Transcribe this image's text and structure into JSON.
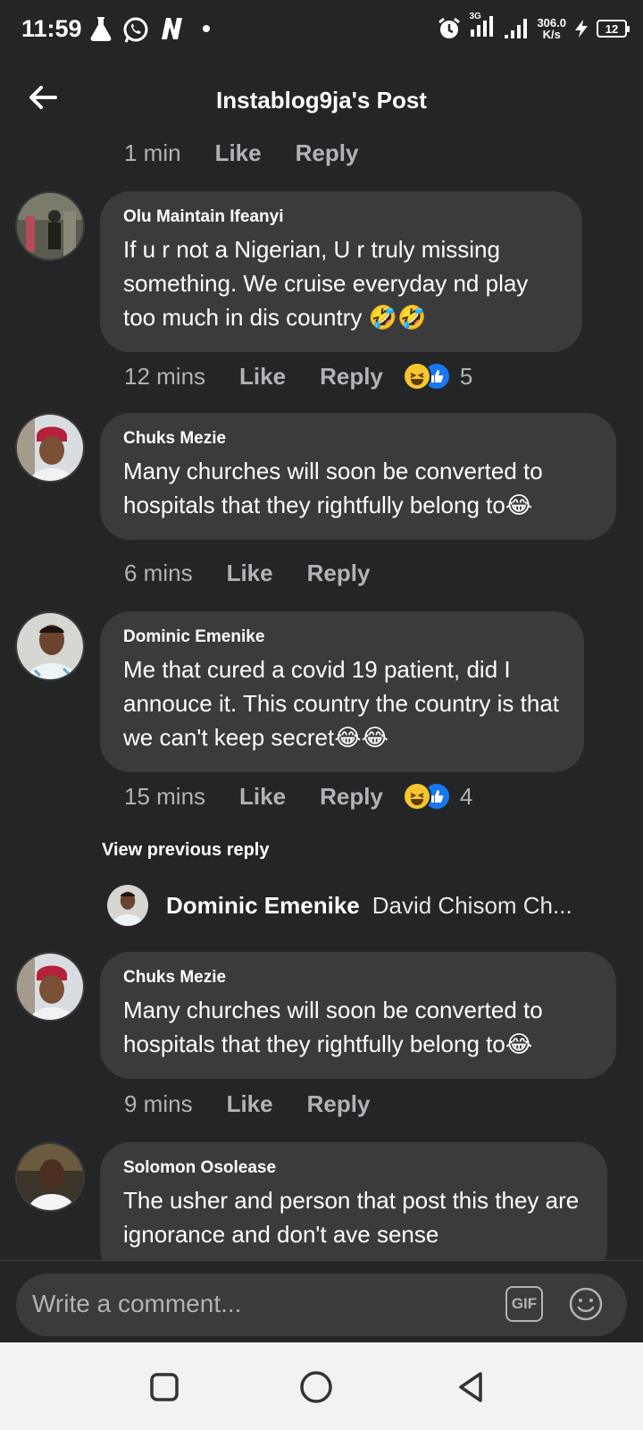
{
  "status_bar": {
    "time": "11:59",
    "network_speed": "306.0",
    "network_unit": "K/s",
    "network_type": "3G",
    "battery": "12",
    "icons": [
      "lab-flask-icon",
      "whatsapp-icon",
      "app-n-icon",
      "dot-icon",
      "alarm-icon",
      "signal-icon",
      "charging-icon"
    ]
  },
  "header": {
    "title": "Instablog9ja's Post",
    "back_icon": "back-arrow-icon"
  },
  "actions": {
    "like": "Like",
    "reply": "Reply"
  },
  "top_meta": {
    "time": "1 min"
  },
  "comments": [
    {
      "name": "Olu Maintain Ifeanyi",
      "text": "If u r not a Nigerian, U r truly missing something. We cruise everyday nd play too much in dis country",
      "emoji": "🤣🤣",
      "time": "12 mins",
      "reaction_count": "5"
    },
    {
      "name": "Chuks Mezie",
      "text": "Many churches will soon be converted to hospitals that they rightfully belong to",
      "emoji": "😂",
      "time": "6 mins"
    },
    {
      "name": "Dominic Emenike",
      "text": "Me that cured a covid 19 patient, did I annouce it. This country the country is that we can't keep secret",
      "emoji": "😂😂",
      "time": "15 mins",
      "reaction_count": "4"
    },
    {
      "name": "Chuks Mezie",
      "text": "Many churches will soon be converted to hospitals that they rightfully belong to",
      "emoji": "😂",
      "time": "9 mins"
    },
    {
      "name": "Solomon Osolease",
      "text": "The usher and person that post this they are ignorance and don't ave sense"
    }
  ],
  "view_previous": "View previous reply",
  "reply_preview": {
    "name": "Dominic Emenike",
    "text": "David Chisom Ch..."
  },
  "composer": {
    "placeholder": "Write a comment...",
    "gif_label": "GIF"
  },
  "colors": {
    "background": "#242527",
    "bubble": "#3a3b3c",
    "muted_text": "#b0b3b8",
    "like_blue": "#1877f2"
  }
}
